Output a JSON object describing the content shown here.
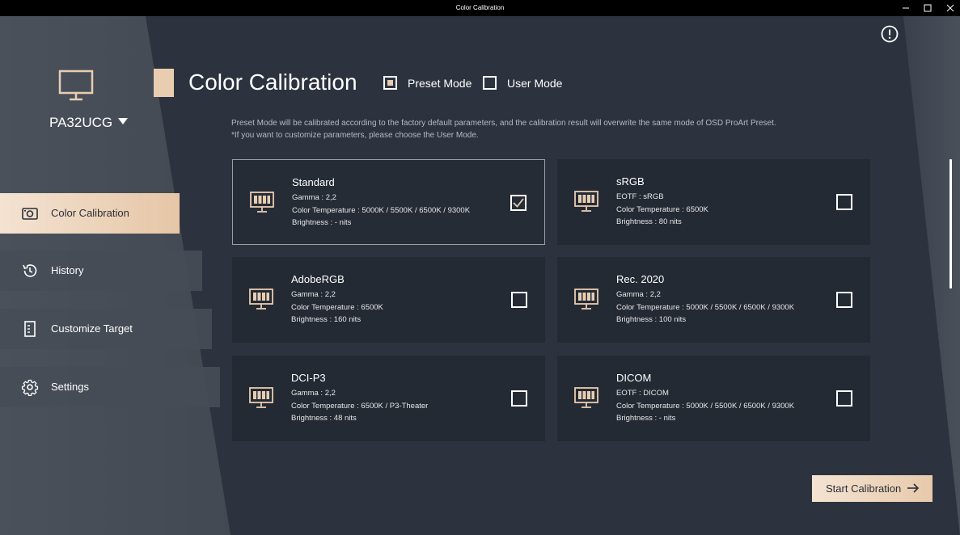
{
  "window": {
    "title": "Color Calibration",
    "minimize_glyph": "—",
    "maximize_glyph": "☐",
    "close_glyph": "✕"
  },
  "sidebar": {
    "model": "PA32UCG",
    "items": [
      {
        "label": "Color Calibration",
        "icon": "camera-icon",
        "active": true
      },
      {
        "label": "History",
        "icon": "history-icon",
        "active": false
      },
      {
        "label": "Customize Target",
        "icon": "document-icon",
        "active": false
      },
      {
        "label": "Settings",
        "icon": "gear-icon",
        "active": false
      }
    ]
  },
  "header": {
    "title": "Color Calibration",
    "preset_mode_label": "Preset Mode",
    "user_mode_label": "User Mode",
    "preset_mode_checked": true,
    "user_mode_checked": false
  },
  "description": {
    "line1": "Preset Mode will be calibrated according to the factory default parameters, and the calibration result will overwrite the same mode of OSD ProArt Preset.",
    "line2": "*If you want to customize parameters, please choose the User Mode."
  },
  "presets": [
    {
      "name": "Standard",
      "line1": "Gamma : 2,2",
      "line2": "Color Temperature : 5000K / 5500K / 6500K / 9300K",
      "line3": "Brightness : - nits",
      "checked": true
    },
    {
      "name": "sRGB",
      "line1": "EOTF : sRGB",
      "line2": "Color Temperature : 6500K",
      "line3": "Brightness : 80 nits",
      "checked": false
    },
    {
      "name": "AdobeRGB",
      "line1": "Gamma : 2,2",
      "line2": "Color Temperature : 6500K",
      "line3": "Brightness : 160 nits",
      "checked": false
    },
    {
      "name": "Rec. 2020",
      "line1": "Gamma : 2,2",
      "line2": "Color Temperature : 5000K / 5500K / 6500K / 9300K",
      "line3": "Brightness : 100 nits",
      "checked": false
    },
    {
      "name": "DCI-P3",
      "line1": "Gamma : 2,2",
      "line2": "Color Temperature : 6500K / P3-Theater",
      "line3": "Brightness : 48 nits",
      "checked": false
    },
    {
      "name": "DICOM",
      "line1": "EOTF : DICOM",
      "line2": "Color Temperature : 5000K / 5500K / 6500K / 9300K",
      "line3": "Brightness : - nits",
      "checked": false
    }
  ],
  "actions": {
    "start_label": "Start Calibration"
  },
  "colors": {
    "accent": "#e8cdb1",
    "background": "#2c333f",
    "card": "#242a34",
    "sidebar": "#4b515b"
  }
}
